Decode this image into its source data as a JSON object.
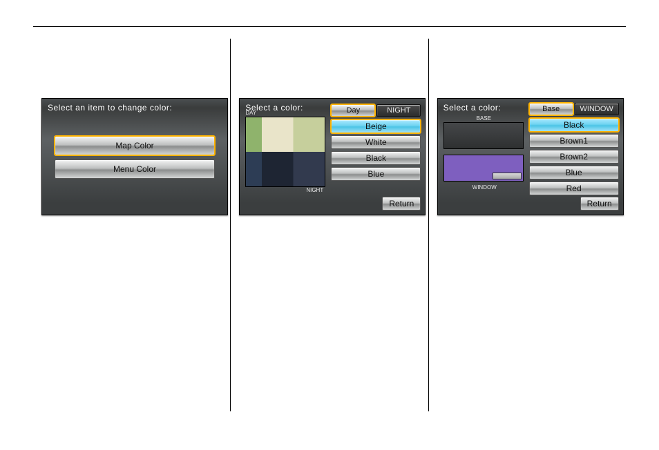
{
  "screen1": {
    "title": "Select an item to change color:",
    "mapColor": "Map Color",
    "menuColor": "Menu Color"
  },
  "screen2": {
    "title": "Select a color:",
    "dayLabel": "DAY",
    "nightLabel": "NIGHT",
    "tabs": {
      "day": "Day",
      "night": "NIGHT"
    },
    "options": {
      "beige": "Beige",
      "white": "White",
      "black": "Black",
      "blue": "Blue"
    },
    "return": "Return"
  },
  "screen3": {
    "title": "Select a color:",
    "baseLabel": "BASE",
    "windowLabel": "WINDOW",
    "tabs": {
      "base": "Base",
      "window": "WINDOW"
    },
    "options": {
      "black": "Black",
      "brown1": "Brown1",
      "brown2": "Brown2",
      "blue": "Blue",
      "red": "Red"
    },
    "return": "Return"
  }
}
